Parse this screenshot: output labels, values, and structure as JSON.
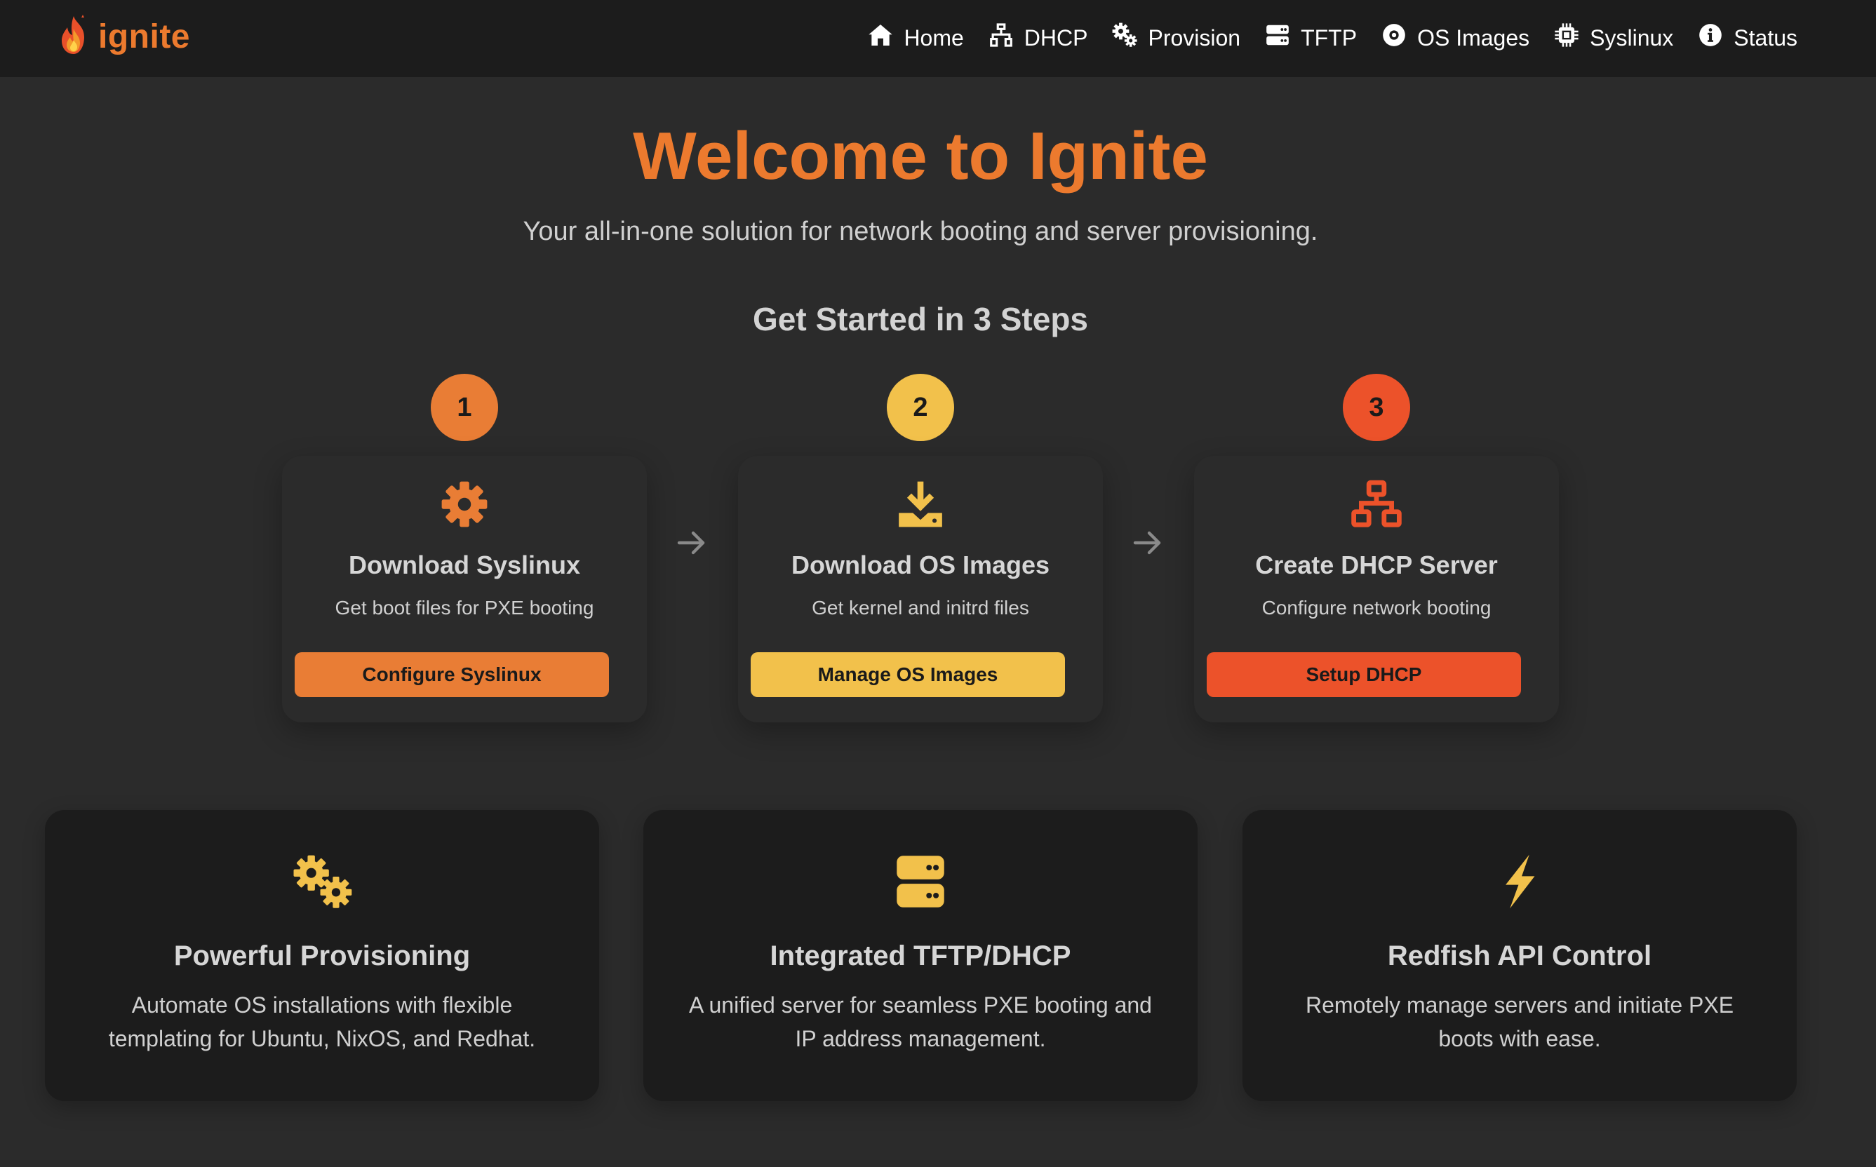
{
  "app": {
    "brand_name": "ignite",
    "accent_color": "#ec7a2e"
  },
  "nav": {
    "items": [
      {
        "label": "Home",
        "icon": "home-icon"
      },
      {
        "label": "DHCP",
        "icon": "network-icon"
      },
      {
        "label": "Provision",
        "icon": "gears-icon"
      },
      {
        "label": "TFTP",
        "icon": "server-icon"
      },
      {
        "label": "OS Images",
        "icon": "disc-icon"
      },
      {
        "label": "Syslinux",
        "icon": "chip-icon"
      },
      {
        "label": "Status",
        "icon": "info-icon"
      }
    ]
  },
  "hero": {
    "title": "Welcome to Ignite",
    "subtitle": "Your all-in-one solution for network booting and server provisioning."
  },
  "steps": {
    "heading": "Get Started in 3 Steps",
    "items": [
      {
        "number": "1",
        "title": "Download Syslinux",
        "description": "Get boot files for PXE booting",
        "button_label": "Configure Syslinux",
        "icon": "gear-icon",
        "color": "#e97d35"
      },
      {
        "number": "2",
        "title": "Download OS Images",
        "description": "Get kernel and initrd files",
        "button_label": "Manage OS Images",
        "icon": "download-icon",
        "color": "#f2c14b"
      },
      {
        "number": "3",
        "title": "Create DHCP Server",
        "description": "Configure network booting",
        "button_label": "Setup DHCP",
        "icon": "network-icon",
        "color": "#ec522a"
      }
    ]
  },
  "features": {
    "icon_color": "#f2c14b",
    "items": [
      {
        "title": "Powerful Provisioning",
        "description": "Automate OS installations with flexible templating for Ubuntu, NixOS, and Redhat.",
        "icon": "gears-icon"
      },
      {
        "title": "Integrated TFTP/DHCP",
        "description": "A unified server for seamless PXE booting and IP address management.",
        "icon": "server-icon"
      },
      {
        "title": "Redfish API Control",
        "description": "Remotely manage servers and initiate PXE boots with ease.",
        "icon": "bolt-icon"
      }
    ]
  }
}
